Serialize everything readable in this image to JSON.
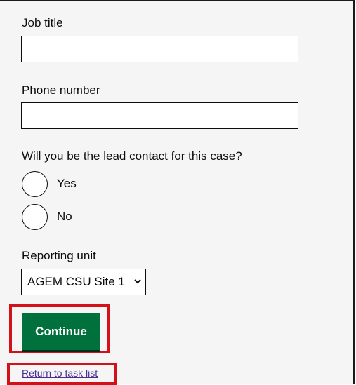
{
  "form": {
    "job_title": {
      "label": "Job title",
      "value": ""
    },
    "phone_number": {
      "label": "Phone number",
      "value": ""
    },
    "lead_contact": {
      "question": "Will you be the lead contact for this case?",
      "options": [
        "Yes",
        "No"
      ]
    },
    "reporting_unit": {
      "label": "Reporting unit",
      "selected": "AGEM CSU Site 1"
    },
    "continue_label": "Continue",
    "return_link": "Return to task list"
  },
  "colors": {
    "button_green": "#00703c",
    "highlight_red": "#d4101b",
    "link_purple": "#4c2c92",
    "background": "#f5f5f5"
  }
}
